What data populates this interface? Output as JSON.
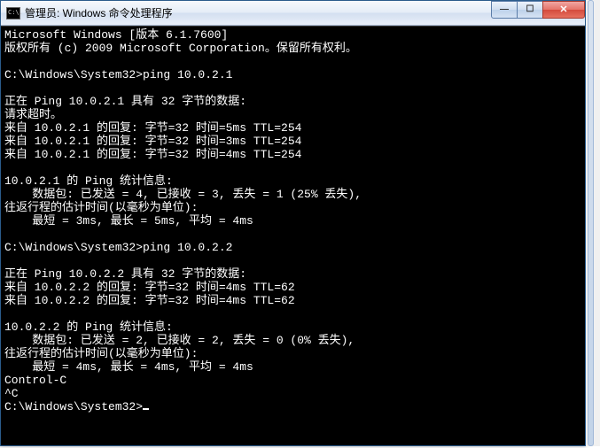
{
  "window": {
    "title": "管理员: Windows 命令处理程序",
    "icon_text": "C:\\."
  },
  "controls": {
    "min": "—",
    "max": "☐",
    "close": "✕"
  },
  "terminal_lines": [
    "Microsoft Windows [版本 6.1.7600]",
    "版权所有 (c) 2009 Microsoft Corporation。保留所有权利。",
    "",
    "C:\\Windows\\System32>ping 10.0.2.1",
    "",
    "正在 Ping 10.0.2.1 具有 32 字节的数据:",
    "请求超时。",
    "来自 10.0.2.1 的回复: 字节=32 时间=5ms TTL=254",
    "来自 10.0.2.1 的回复: 字节=32 时间=3ms TTL=254",
    "来自 10.0.2.1 的回复: 字节=32 时间=4ms TTL=254",
    "",
    "10.0.2.1 的 Ping 统计信息:",
    "    数据包: 已发送 = 4, 已接收 = 3, 丢失 = 1 (25% 丢失),",
    "往返行程的估计时间(以毫秒为单位):",
    "    最短 = 3ms, 最长 = 5ms, 平均 = 4ms",
    "",
    "C:\\Windows\\System32>ping 10.0.2.2",
    "",
    "正在 Ping 10.0.2.2 具有 32 字节的数据:",
    "来自 10.0.2.2 的回复: 字节=32 时间=4ms TTL=62",
    "来自 10.0.2.2 的回复: 字节=32 时间=4ms TTL=62",
    "",
    "10.0.2.2 的 Ping 统计信息:",
    "    数据包: 已发送 = 2, 已接收 = 2, 丢失 = 0 (0% 丢失),",
    "往返行程的估计时间(以毫秒为单位):",
    "    最短 = 4ms, 最长 = 4ms, 平均 = 4ms",
    "Control-C",
    "^C",
    "C:\\Windows\\System32>"
  ]
}
